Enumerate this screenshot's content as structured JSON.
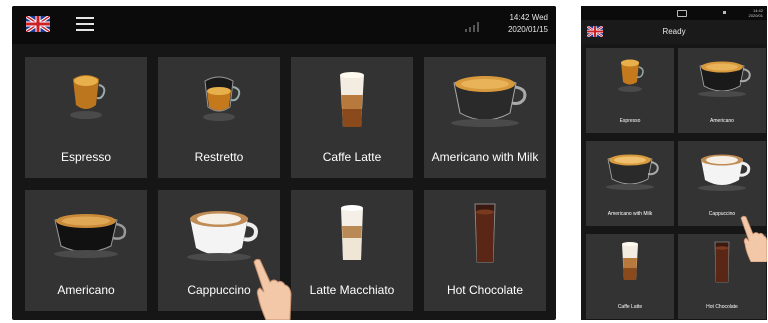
{
  "left_screen": {
    "clock": {
      "time": "14:42 Wed",
      "date": "2020/01/15"
    },
    "drinks": [
      {
        "label": "Espresso",
        "icon": "espresso-glass-icon"
      },
      {
        "label": "Restretto",
        "icon": "espresso-glass-icon"
      },
      {
        "label": "Caffe Latte",
        "icon": "latte-glass-icon"
      },
      {
        "label": "Americano with Milk",
        "icon": "wide-cup-icon"
      },
      {
        "label": "Americano",
        "icon": "glass-cup-icon"
      },
      {
        "label": "Cappuccino",
        "icon": "white-cup-icon"
      },
      {
        "label": "Latte Macchiato",
        "icon": "macchiato-glass-icon"
      },
      {
        "label": "Hot Chocolate",
        "icon": "chocolate-glass-icon"
      }
    ]
  },
  "right_screen": {
    "title": "Ready",
    "clock": {
      "time": "14:42",
      "date": "2020/01"
    },
    "drinks": [
      {
        "label": "Espresso",
        "icon": "espresso-glass-icon"
      },
      {
        "label": "Americano",
        "icon": "wide-cup-icon"
      },
      {
        "label": "Americano with Milk",
        "icon": "wide-cup-icon"
      },
      {
        "label": "Cappuccino",
        "icon": "white-cup-icon"
      },
      {
        "label": "Caffe Latte",
        "icon": "latte-glass-icon"
      },
      {
        "label": "Hot Chocolate",
        "icon": "chocolate-glass-icon"
      }
    ]
  }
}
